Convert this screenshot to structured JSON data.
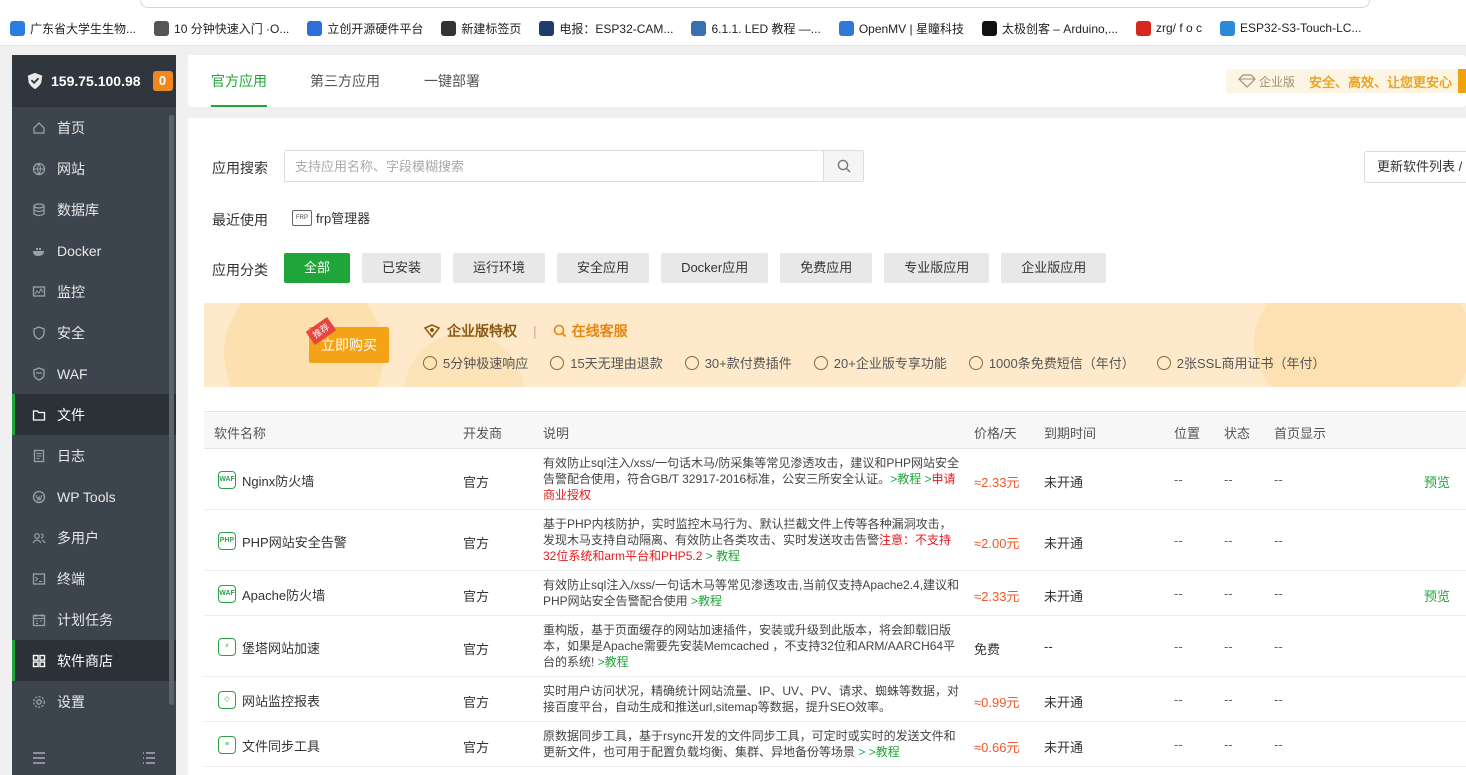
{
  "bookmarks": [
    {
      "label": "广东省大学生生物...",
      "icon": "globe-icon",
      "color": "#2a7de1"
    },
    {
      "label": "10 分钟快速入门 ·O...",
      "icon": "book-icon",
      "color": "#555555"
    },
    {
      "label": "立创开源硬件平台",
      "icon": "lc-icon",
      "color": "#2f6fdc"
    },
    {
      "label": "新建标签页",
      "icon": "newtab-icon",
      "color": "#333333"
    },
    {
      "label": "电报：ESP32-CAM...",
      "icon": "r-icon",
      "color": "#1e3c6e"
    },
    {
      "label": "6.1.1. LED 教程 —...",
      "icon": "gear-icon",
      "color": "#3a6fb0"
    },
    {
      "label": "OpenMV | 星瞳科技",
      "icon": "openmv-icon",
      "color": "#2f7ad8"
    },
    {
      "label": "太极创客 – Arduino,...",
      "icon": "taiji-icon",
      "color": "#111111"
    },
    {
      "label": "zrg/ f o c",
      "icon": "gitee-icon",
      "color": "#d6281e"
    },
    {
      "label": "ESP32-S3-Touch-LC...",
      "icon": "waveshare-icon",
      "color": "#2a8ad8"
    }
  ],
  "sidebar": {
    "ip": "159.75.100.98",
    "badge": "0",
    "items": [
      {
        "label": "首页",
        "icon": "home-icon"
      },
      {
        "label": "网站",
        "icon": "globe-icon"
      },
      {
        "label": "数据库",
        "icon": "database-icon"
      },
      {
        "label": "Docker",
        "icon": "docker-icon"
      },
      {
        "label": "监控",
        "icon": "monitor-icon"
      },
      {
        "label": "安全",
        "icon": "shield-icon"
      },
      {
        "label": "WAF",
        "icon": "waf-icon"
      },
      {
        "label": "文件",
        "icon": "folder-icon"
      },
      {
        "label": "日志",
        "icon": "log-icon"
      },
      {
        "label": "WP Tools",
        "icon": "wordpress-icon"
      },
      {
        "label": "多用户",
        "icon": "users-icon"
      },
      {
        "label": "终端",
        "icon": "terminal-icon"
      },
      {
        "label": "计划任务",
        "icon": "calendar-icon"
      },
      {
        "label": "软件商店",
        "icon": "grid-icon"
      },
      {
        "label": "设置",
        "icon": "settings-icon"
      }
    ],
    "active_items": [
      "文件",
      "软件商店"
    ]
  },
  "tabs": [
    "官方应用",
    "第三方应用",
    "一键部署"
  ],
  "enterprise": {
    "badge": "企业版",
    "slogan": "安全、高效、让您更安心"
  },
  "search": {
    "label": "应用搜索",
    "placeholder": "支持应用名称、字段模糊搜索"
  },
  "update_button": "更新软件列表 / 支",
  "recent": {
    "label": "最近使用",
    "item": "frp管理器",
    "icon_text": "FRP"
  },
  "categories": {
    "label": "应用分类",
    "items": [
      "全部",
      "已安装",
      "运行环境",
      "安全应用",
      "Docker应用",
      "免费应用",
      "专业版应用",
      "企业版应用"
    ],
    "active": "全部"
  },
  "banner": {
    "tag": "推荐",
    "buy": "立即购买",
    "privilege": "企业版特权",
    "service": "在线客服",
    "features": [
      "5分钟极速响应",
      "15天无理由退款",
      "30+款付费插件",
      "20+企业版专享功能",
      "1000条免费短信（年付）",
      "2张SSL商用证书（年付）"
    ]
  },
  "table": {
    "headers": [
      "软件名称",
      "开发商",
      "说明",
      "价格/天",
      "到期时间",
      "位置",
      "状态",
      "首页显示"
    ],
    "rows": [
      {
        "name": "Nginx防火墙",
        "icon": "WAF",
        "dev": "官方",
        "desc": [
          "有效防止sql注入/xss/一句话木马/防采集等常见渗透攻击，建议和PHP网站安全告警配合使用，符合GB/T 32917-2016标准，公安三所安全认证。",
          ">教程 >",
          "申请商业授权"
        ],
        "price": "≈2.33元",
        "expire": "未开通",
        "pos": "--",
        "status": "--",
        "home": "--",
        "preview": "预览"
      },
      {
        "name": "PHP网站安全告警",
        "icon": "PHP",
        "dev": "官方",
        "desc": [
          "基于PHP内核防护，实时监控木马行为、默认拦截文件上传等各种漏洞攻击，发现木马支持自动隔离、有效防止各类攻击、实时发送攻击告警",
          "注意：不支持32位系统和arm平台和PHP5.2",
          " > 教程"
        ],
        "price": "≈2.00元",
        "expire": "未开通",
        "pos": "--",
        "status": "--",
        "home": "--",
        "preview": ""
      },
      {
        "name": "Apache防火墙",
        "icon": "WAF",
        "dev": "官方",
        "desc": [
          "有效防止sql注入/xss/一句话木马等常见渗透攻击,当前仅支持Apache2.4,建议和PHP网站安全告警配合使用 ",
          ">教程"
        ],
        "price": "≈2.33元",
        "expire": "未开通",
        "pos": "--",
        "status": "--",
        "home": "--",
        "preview": "预览"
      },
      {
        "name": "堡塔网站加速",
        "icon": "⚡",
        "dev": "官方",
        "desc": [
          "重构版，基于页面缓存的网站加速插件，安装或升级到此版本，将会卸载旧版本，如果是Apache需要先安装Memcached ，不支持32位和ARM/AARCH64平台的系统! ",
          ">教程"
        ],
        "price": "免费",
        "expire": "--",
        "pos": "--",
        "status": "--",
        "home": "--",
        "preview": ""
      },
      {
        "name": "网站监控报表",
        "icon": "◇",
        "dev": "官方",
        "desc": [
          "实时用户访问状况，精确统计网站流量、IP、UV、PV、请求、蜘蛛等数据，对接百度平台，自动生成和推送url,sitemap等数据，提升SEO效率。",
          ""
        ],
        "price": "≈0.99元",
        "expire": "未开通",
        "pos": "--",
        "status": "--",
        "home": "--",
        "preview": ""
      },
      {
        "name": "文件同步工具",
        "icon": "≡",
        "dev": "官方",
        "desc": [
          "原数据同步工具，基于rsync开发的文件同步工具，可定时或实时的发送文件和更新文件，也可用于配置负载均衡、集群、异地备份等场景 ",
          "> >教程"
        ],
        "price": "≈0.66元",
        "expire": "未开通",
        "pos": "--",
        "status": "--",
        "home": "--",
        "preview": ""
      }
    ]
  }
}
